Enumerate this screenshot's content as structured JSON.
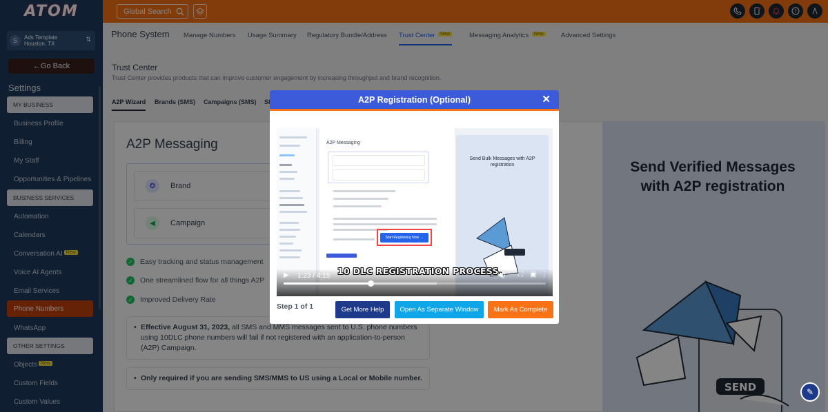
{
  "brand": {
    "logo_text": "ATOM"
  },
  "topbar": {
    "search_label": "Global Search",
    "icons": [
      "phone-icon",
      "mobile-notification-icon",
      "bell-icon",
      "help-icon",
      "user-icon"
    ]
  },
  "account": {
    "avatar_letter": "S",
    "name": "Ads Template",
    "location": "Houston, TX"
  },
  "sidebar": {
    "back_label": "Go Back",
    "settings_title": "Settings",
    "sections": {
      "my_business": "MY BUSINESS",
      "business_services": "BUSINESS SERVICES",
      "other_settings": "OTHER SETTINGS"
    },
    "items": {
      "business_profile": "Business Profile",
      "billing": "Billing",
      "my_staff": "My Staff",
      "opportunities": "Opportunities & Pipelines",
      "automation": "Automation",
      "calendars": "Calendars",
      "conversation_ai": "Conversation AI",
      "voice_ai": "Voice AI Agents",
      "email_services": "Email Services",
      "phone_numbers": "Phone Numbers",
      "whatsapp": "WhatsApp",
      "objects": "Objects",
      "custom_fields": "Custom Fields",
      "custom_values": "Custom Values"
    },
    "new_badge": "New"
  },
  "tabs": {
    "title": "Phone System",
    "manage_numbers": "Manage Numbers",
    "usage_summary": "Usage Summary",
    "regulatory": "Regulatory Bundle/Address",
    "trust_center": "Trust Center",
    "messaging_analytics": "Messaging Analytics",
    "advanced_settings": "Advanced Settings",
    "new_badge": "New"
  },
  "trust_center": {
    "title": "Trust Center",
    "subtitle": "Trust Center provides products that can improve customer engagement by increasing throughput and brand recognition.",
    "subtabs": {
      "wizard": "A2P Wizard",
      "brands": "Brands (SMS)",
      "campaigns": "Campaigns (SMS)",
      "sh": "SH"
    }
  },
  "a2p": {
    "title": "A2P Messaging",
    "brand": "Brand",
    "campaign": "Campaign",
    "checks": [
      "Easy tracking and status management",
      "One streamlined flow for all things A2P",
      "Improved Delivery Rate"
    ],
    "note1_bold": "Effective August 31, 2023,",
    "note1_rest": " all SMS and MMS messages sent to U.S. phone numbers using 10DLC phone numbers will fail if not registered with an application-to-person (A2P) Campaign.",
    "note2": "Only required if you are sending SMS/MMS to US using a Local or Mobile number.",
    "promo": "Send Verified Messages with A2P registration"
  },
  "modal": {
    "title": "A2P Registration (Optional)",
    "close": "✕",
    "video": {
      "mini_title": "A2P Messaging",
      "mini_promo": "Send Bulk Messages with A2P registration",
      "highlight_btn": "Start Registering Now →",
      "caption": "10 DLC REGISTRATION PROCESS.",
      "time": "1:23 / 4:15",
      "progress_fraction": 0.33
    },
    "step_label": "Step 1 of 1",
    "buttons": {
      "help": "Get More Help",
      "separate": "Open As Separate Window",
      "complete": "Mark As Complete"
    }
  },
  "illustration": {
    "send_label": "SEND"
  },
  "colors": {
    "primary_orange": "#f97316",
    "sidebar_bg": "#1e3a5f",
    "accent_blue": "#3b5bdb"
  }
}
